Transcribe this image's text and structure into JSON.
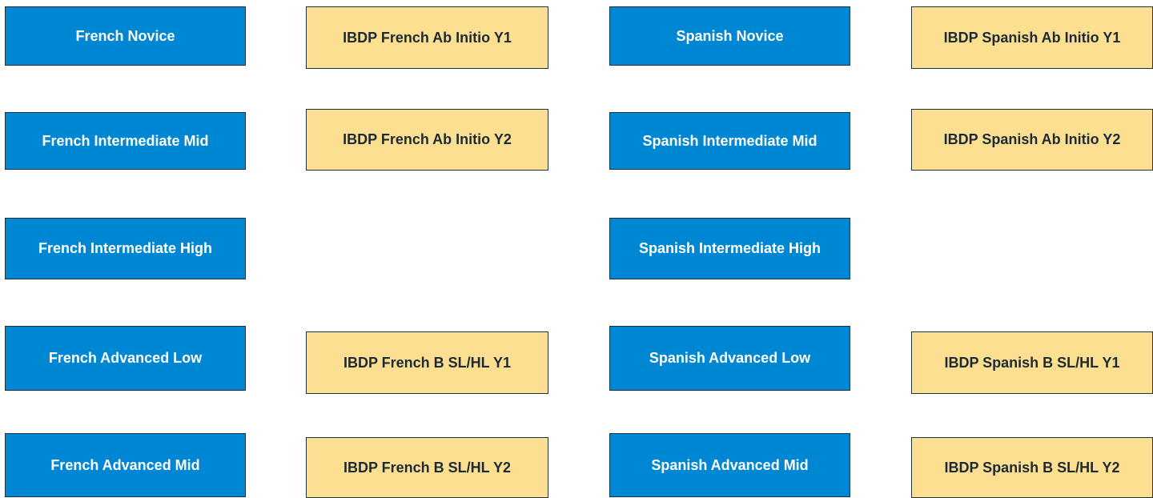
{
  "colors": {
    "blue": "#0087d3",
    "yellow": "#fddf92"
  },
  "french": {
    "novice": "French Novice",
    "intermediate_mid": "French Intermediate Mid",
    "intermediate_high": "French Intermediate High",
    "advanced_low": "French Advanced Low",
    "advanced_mid": "French Advanced Mid"
  },
  "ibdp_french": {
    "ab_initio_y1": "IBDP French Ab Initio Y1",
    "ab_initio_y2": "IBDP French Ab Initio Y2",
    "b_y1": "IBDP French B SL/HL Y1",
    "b_y2": "IBDP French B SL/HL Y2"
  },
  "spanish": {
    "novice": "Spanish Novice",
    "intermediate_mid": "Spanish Intermediate Mid",
    "intermediate_high": "Spanish Intermediate High",
    "advanced_low": "Spanish Advanced Low",
    "advanced_mid": "Spanish Advanced Mid"
  },
  "ibdp_spanish": {
    "ab_initio_y1": "IBDP Spanish Ab Initio Y1",
    "ab_initio_y2": "IBDP Spanish Ab Initio Y2",
    "b_y1": "IBDP Spanish B SL/HL Y1",
    "b_y2": "IBDP Spanish B SL/HL Y2"
  }
}
